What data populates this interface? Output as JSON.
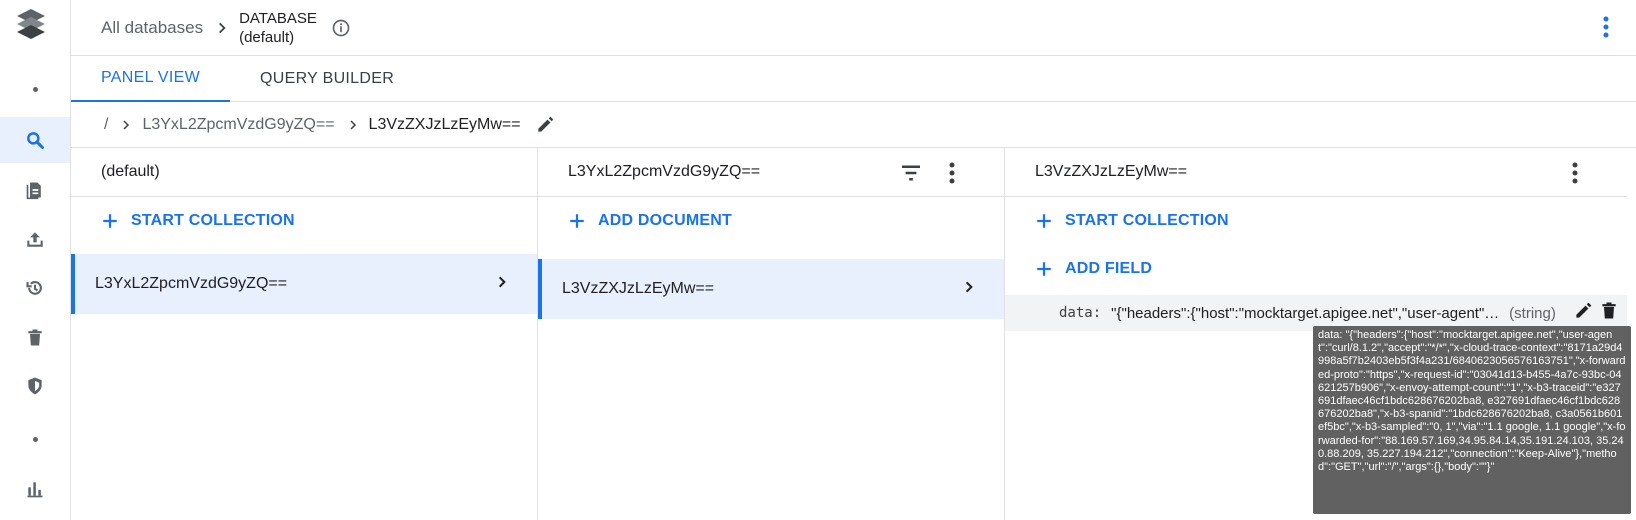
{
  "rail": {
    "items": [
      {
        "icon": "dot-icon"
      },
      {
        "icon": "search-icon",
        "active": true
      },
      {
        "icon": "rules-icon"
      },
      {
        "icon": "upload-icon"
      },
      {
        "icon": "history-icon"
      },
      {
        "icon": "delete-icon"
      },
      {
        "icon": "shield-icon"
      },
      {
        "icon": "dot-icon"
      },
      {
        "icon": "bar-chart-icon"
      }
    ]
  },
  "header": {
    "all_databases": "All databases",
    "database_label": "DATABASE",
    "database_name": "(default)"
  },
  "tabs": [
    {
      "label": "PANEL VIEW",
      "active": true
    },
    {
      "label": "QUERY BUILDER",
      "active": false
    }
  ],
  "path": {
    "root": "/",
    "segment1": "L3YxL2ZpcmVzdG9yZQ==",
    "segment2": "L3VzZXJzLzEyMw=="
  },
  "panels": {
    "root": {
      "title": "(default)",
      "action": "START COLLECTION",
      "item": "L3YxL2ZpcmVzdG9yZQ=="
    },
    "collection": {
      "title": "L3YxL2ZpcmVzdG9yZQ==",
      "action": "ADD DOCUMENT",
      "item": "L3VzZXJzLzEyMw=="
    },
    "document": {
      "title": "L3VzZXJzLzEyMw==",
      "action_collection": "START COLLECTION",
      "action_field": "ADD FIELD",
      "field_key": "data:",
      "field_value": "\"{\"headers\":{\"host\":\"mocktarget.apigee.net\",\"user-agent\":\"c...",
      "field_type": "(string)"
    }
  },
  "tooltip": {
    "text": "data: \"{\"headers\":{\"host\":\"mocktarget.apigee.net\",\"user-agent\":\"curl/8.1.2\",\"accept\":\"*/*\",\"x-cloud-trace-context\":\"8171a29d4998a5f7b2403eb5f3f4a231/6840623056576163751\",\"x-forwarded-proto\":\"https\",\"x-request-id\":\"03041d13-b455-4a7c-93bc-04621257b906\",\"x-envoy-attempt-count\":\"1\",\"x-b3-traceid\":\"e327691dfaec46cf1bdc628676202ba8, e327691dfaec46cf1bdc628676202ba8\",\"x-b3-spanid\":\"1bdc628676202ba8, c3a0561b601ef5bc\",\"x-b3-sampled\":\"0, 1\",\"via\":\"1.1 google, 1.1 google\",\"x-forwarded-for\":\"88.169.57.169,34.95.84.14,35.191.24.103, 35.240.88.209, 35.227.194.212\",\"connection\":\"Keep-Alive\"},\"method\":\"GET\",\"url\":\"/\",\"args\":{},\"body\":\"\"}\""
  },
  "colors": {
    "accent": "#1a73e8",
    "selected_bg": "#e8f0fe",
    "tooltip_bg": "#616161"
  }
}
